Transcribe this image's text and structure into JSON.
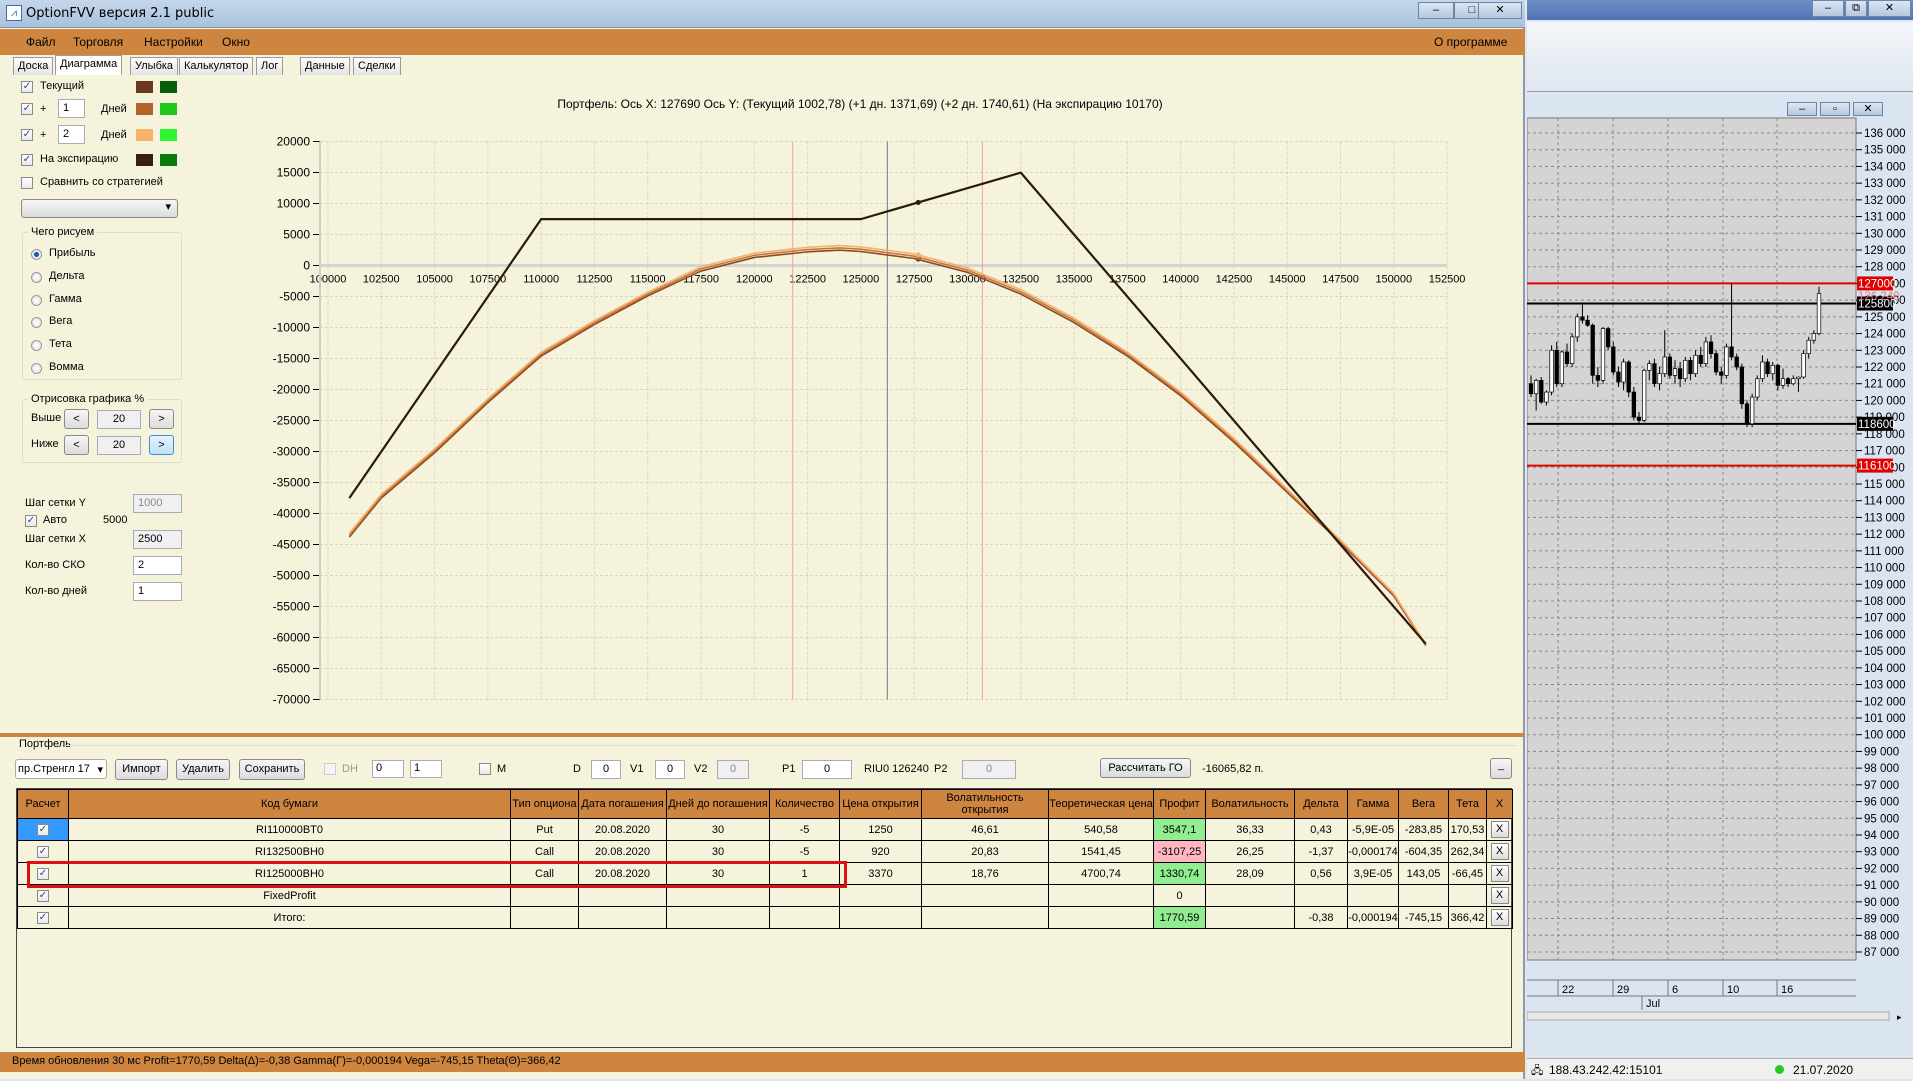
{
  "window": {
    "title": "OptionFVV версия 2.1 public",
    "min": "‒",
    "max": "□",
    "close": "✕"
  },
  "menu": {
    "items": [
      "Файл",
      "Торговля",
      "Настройки",
      "Окно"
    ],
    "about": "О программе"
  },
  "tabs": [
    "Доска",
    "Диаграмма",
    "Улыбка",
    "Калькулятор",
    "Лог",
    "Данные",
    "Сделки"
  ],
  "active_tab": "Диаграмма",
  "left": {
    "series": [
      {
        "label": "Текущий",
        "checked": true,
        "color": "#6b3a1e",
        "color2": "#0a5e0a"
      },
      {
        "label": "+",
        "days": "1",
        "unit": "Дней",
        "checked": true,
        "color": "#b5612b",
        "color2": "#1ec81e"
      },
      {
        "label": "+",
        "days": "2",
        "unit": "Дней",
        "checked": true,
        "color": "#f7b26c",
        "color2": "#2ef52e"
      },
      {
        "label": "На экспирацию",
        "checked": true,
        "color": "#3a1f0a",
        "color2": "#0a7a0a"
      }
    ],
    "compare": {
      "label": "Сравнить со стратегией",
      "checked": false,
      "select": ""
    },
    "draw_group": {
      "title": "Чего рисуем",
      "options": [
        "Прибыль",
        "Дельта",
        "Гамма",
        "Вега",
        "Тета",
        "Вомма"
      ],
      "selected": "Прибыль"
    },
    "range_group": {
      "title": "Отрисовка графика %",
      "above_label": "Выше",
      "above": "20",
      "below_label": "Ниже",
      "below": "20",
      "dec": "<",
      "inc": ">"
    },
    "grid_y_label": "Шаг сетки Y",
    "grid_y": "1000",
    "auto_label": "Авто",
    "auto_checked": true,
    "auto_value": "5000",
    "grid_x_label": "Шаг сетки X",
    "grid_x": "2500",
    "sko_label": "Кол-во СКО",
    "sko": "2",
    "days_label": "Кол-во дней",
    "days": "1"
  },
  "chart_data": {
    "type": "line",
    "title": "Портфель: Ось X: 127690 Ось Y:  (Текущий 1002,78)  (+1 дн. 1371,69)  (+2 дн. 1740,61)  (На экспирацию 10170)",
    "xlim": [
      100000,
      152500
    ],
    "ylim": [
      -70000,
      20000
    ],
    "x_ticks": [
      100000,
      102500,
      105000,
      107500,
      110000,
      112500,
      115000,
      117500,
      120000,
      122500,
      125000,
      127500,
      130000,
      132500,
      135000,
      137500,
      140000,
      142500,
      145000,
      147500,
      150000,
      152500
    ],
    "y_ticks": [
      20000,
      15000,
      10000,
      5000,
      0,
      -5000,
      -10000,
      -15000,
      -20000,
      -25000,
      -30000,
      -35000,
      -40000,
      -45000,
      -50000,
      -55000,
      -60000,
      -65000,
      -70000
    ],
    "grid": true,
    "cursor_x": 127690,
    "current_price": 126240,
    "sko_bounds": [
      121800,
      130700
    ],
    "x": [
      101000,
      102500,
      105000,
      107500,
      110000,
      112500,
      115000,
      117500,
      120000,
      122500,
      124000,
      125000,
      127500,
      130000,
      132500,
      135000,
      137500,
      140000,
      142500,
      145000,
      147500,
      150000,
      151500
    ],
    "series": [
      {
        "name": "Текущий",
        "color": "#8a4a20",
        "values": [
          -43800,
          -37500,
          -30200,
          -22100,
          -14600,
          -9500,
          -4900,
          -900,
          1300,
          2200,
          2470,
          2260,
          1130,
          -1100,
          -4600,
          -9200,
          -14600,
          -21000,
          -28500,
          -36600,
          -44700,
          -53300,
          -61300
        ]
      },
      {
        "name": "+1 дн.",
        "color": "#c8763a",
        "values": [
          -43500,
          -37200,
          -29900,
          -21800,
          -14300,
          -9200,
          -4600,
          -550,
          1650,
          2570,
          2840,
          2630,
          1500,
          -750,
          -4250,
          -8850,
          -14300,
          -20700,
          -28200,
          -36350,
          -44500,
          -53100,
          -61200
        ]
      },
      {
        "name": "+2 дн.",
        "color": "#f5b070",
        "values": [
          -43200,
          -36900,
          -29600,
          -21500,
          -14000,
          -8900,
          -4300,
          -200,
          2000,
          2940,
          3210,
          3000,
          1870,
          -400,
          -3900,
          -8500,
          -14000,
          -20400,
          -27900,
          -36100,
          -44300,
          -52900,
          -61100
        ]
      },
      {
        "name": "На экспирацию",
        "color": "#2b1a08",
        "x": [
          101000,
          110000,
          125000,
          132500,
          151500
        ],
        "values": [
          -37520,
          7480,
          7480,
          14980,
          -61020
        ]
      }
    ],
    "markers": [
      {
        "series": "Текущий",
        "x": 127690,
        "y": 1002.78
      },
      {
        "series": "+1 дн.",
        "x": 127690,
        "y": 1371.69
      },
      {
        "series": "+2 дн.",
        "x": 127690,
        "y": 1740.61
      },
      {
        "series": "На экспирацию",
        "x": 127690,
        "y": 10170
      }
    ]
  },
  "portfolio": {
    "title": "Портфель",
    "strategy": "пр.Стренгл 17",
    "import": "Импорт",
    "delete": "Удалить",
    "save": "Сохранить",
    "dh_label": "DH",
    "spin1": "0",
    "spin2": "1",
    "m_label": "M",
    "d_label": "D",
    "d": "0",
    "v1_label": "V1",
    "v1": "0",
    "v2_label": "V2",
    "v2": "0",
    "p1_label": "P1",
    "p1": "0",
    "ticker": "RIU0 126240",
    "p2_label": "P2",
    "p2": "0",
    "calc_go": "Рассчитать ГО",
    "go_value": "-16065,82 п.",
    "minimize": "_",
    "columns": [
      "Расчет",
      "Код бумаги",
      "Тип опциона",
      "Дата погашения",
      "Дней до погашения",
      "Количество",
      "Цена открытия",
      "Волатильность открытия",
      "Теоретическая цена",
      "Профит",
      "Волатильность",
      "Дельта",
      "Гамма",
      "Вега",
      "Тета",
      "X"
    ],
    "rows": [
      {
        "calc": true,
        "code": "RI110000BT0",
        "type": "Put",
        "date": "20.08.2020",
        "days": "30",
        "qty": "-5",
        "open": "1250",
        "vol_open": "46,61",
        "theo": "540,58",
        "profit": "3547,1",
        "profit_state": "pos",
        "vol": "36,33",
        "delta": "0,43",
        "gamma": "-5,9E-05",
        "vega": "-283,85",
        "theta": "170,53",
        "x": "X"
      },
      {
        "calc": true,
        "code": "RI132500BH0",
        "type": "Call",
        "date": "20.08.2020",
        "days": "30",
        "qty": "-5",
        "open": "920",
        "vol_open": "20,83",
        "theo": "1541,45",
        "profit": "-3107,25",
        "profit_state": "neg",
        "vol": "26,25",
        "delta": "-1,37",
        "gamma": "-0,000174",
        "vega": "-604,35",
        "theta": "262,34",
        "x": "X"
      },
      {
        "calc": true,
        "code": "RI125000BH0",
        "type": "Call",
        "date": "20.08.2020",
        "days": "30",
        "qty": "1",
        "open": "3370",
        "vol_open": "18,76",
        "theo": "4700,74",
        "profit": "1330,74",
        "profit_state": "pos",
        "vol": "28,09",
        "delta": "0,56",
        "gamma": "3,9E-05",
        "vega": "143,05",
        "theta": "-66,45",
        "x": "X"
      },
      {
        "calc": true,
        "code": "FixedProfit",
        "type": "",
        "date": "",
        "days": "",
        "qty": "",
        "open": "",
        "vol_open": "",
        "theo": "",
        "profit": "0",
        "profit_state": "",
        "vol": "",
        "delta": "",
        "gamma": "",
        "vega": "",
        "theta": "",
        "x": "X"
      },
      {
        "calc": true,
        "code": "Итого:",
        "type": "",
        "date": "",
        "days": "",
        "qty": "",
        "open": "",
        "vol_open": "",
        "theo": "",
        "profit": "1770,59",
        "profit_state": "pos",
        "vol": "",
        "delta": "-0,38",
        "gamma": "-0,000194",
        "vega": "-745,15",
        "theta": "366,42",
        "x": "X"
      }
    ]
  },
  "status": "Время обновления 30 мс  Profit=1770,59 Delta(Δ)=-0,38 Gamma(Γ)=-0,000194 Vega=-745,15 Theta(Θ)=366,42",
  "price_chart": {
    "y_labels": [
      "136 000",
      "135 000",
      "134 000",
      "133 000",
      "132 000",
      "131 000",
      "130 000",
      "129 000",
      "128 000",
      "127 000",
      "126 000",
      "125 000",
      "124 000",
      "123 000",
      "122 000",
      "121 000",
      "120 000",
      "119 000",
      "118 000",
      "117 000",
      "116 000",
      "115 000",
      "114 000",
      "113 000",
      "112 000",
      "111 000",
      "110 000",
      "109 000",
      "108 000",
      "107 000",
      "106 000",
      "105 000",
      "104 000",
      "103 000",
      "102 000",
      "101 000",
      "100 000",
      "99 000",
      "98 000",
      "97 000",
      "96 000",
      "95 000",
      "94 000",
      "93 000",
      "92 000",
      "91 000",
      "90 000",
      "89 000",
      "88 000",
      "87 000"
    ],
    "levels": [
      {
        "value": 127000,
        "label": "127000",
        "color": "#e00000"
      },
      {
        "value": 125800,
        "label": "125800",
        "color": "#000000"
      },
      {
        "value": 118600,
        "label": "118600",
        "color": "#000000"
      },
      {
        "value": 116100,
        "label": "116100",
        "color": "#e00000"
      }
    ],
    "last_price": "126 240",
    "dates": [
      "22",
      "29",
      "6",
      "10",
      "16"
    ],
    "month": "Jul",
    "candles": [
      [
        121.0,
        121.5,
        120.2,
        120.4
      ],
      [
        120.4,
        121.3,
        119.4,
        121.2
      ],
      [
        121.2,
        121.4,
        119.8,
        119.9
      ],
      [
        119.9,
        120.6,
        119.7,
        120.5
      ],
      [
        120.5,
        123.3,
        120.3,
        123.0
      ],
      [
        123.0,
        123.5,
        120.8,
        121.0
      ],
      [
        121.0,
        123.0,
        120.8,
        122.9
      ],
      [
        122.9,
        123.4,
        122.0,
        122.2
      ],
      [
        122.2,
        124.0,
        122.0,
        123.8
      ],
      [
        123.8,
        125.2,
        123.5,
        125.0
      ],
      [
        125.0,
        125.8,
        124.6,
        124.8
      ],
      [
        124.8,
        125.1,
        124.4,
        124.5
      ],
      [
        124.5,
        124.6,
        121.0,
        121.5
      ],
      [
        121.5,
        122.0,
        120.8,
        121.2
      ],
      [
        121.2,
        124.4,
        121.0,
        124.3
      ],
      [
        124.3,
        124.4,
        123.0,
        123.2
      ],
      [
        123.2,
        123.5,
        121.5,
        121.7
      ],
      [
        121.7,
        122.0,
        120.8,
        121.1
      ],
      [
        121.1,
        122.5,
        120.6,
        122.3
      ],
      [
        122.3,
        122.4,
        120.2,
        120.5
      ],
      [
        120.5,
        120.8,
        118.8,
        119.0
      ],
      [
        119.0,
        119.3,
        118.6,
        118.8
      ],
      [
        118.8,
        121.9,
        118.7,
        121.8
      ],
      [
        121.8,
        122.4,
        121.2,
        122.2
      ],
      [
        122.2,
        122.5,
        120.8,
        121.0
      ],
      [
        121.0,
        122.0,
        120.6,
        121.6
      ],
      [
        121.6,
        124.2,
        121.4,
        122.6
      ],
      [
        122.6,
        122.8,
        121.3,
        121.5
      ],
      [
        121.5,
        122.4,
        121.0,
        121.9
      ],
      [
        121.9,
        122.3,
        120.8,
        121.3
      ],
      [
        121.3,
        122.6,
        121.1,
        122.4
      ],
      [
        122.4,
        122.6,
        121.2,
        121.6
      ],
      [
        121.6,
        123.0,
        121.4,
        122.7
      ],
      [
        122.7,
        123.2,
        122.0,
        122.2
      ],
      [
        122.2,
        123.8,
        122.0,
        123.5
      ],
      [
        123.5,
        123.9,
        122.5,
        122.8
      ],
      [
        122.8,
        123.0,
        121.5,
        121.7
      ],
      [
        121.7,
        122.0,
        121.0,
        121.5
      ],
      [
        121.5,
        123.4,
        121.3,
        123.2
      ],
      [
        123.2,
        127.0,
        122.4,
        122.6
      ],
      [
        122.6,
        122.8,
        121.8,
        122.0
      ],
      [
        122.0,
        122.2,
        119.5,
        119.8
      ],
      [
        119.8,
        120.0,
        118.4,
        118.6
      ],
      [
        118.6,
        120.4,
        118.4,
        120.2
      ],
      [
        120.2,
        121.5,
        120.0,
        121.3
      ],
      [
        121.3,
        122.7,
        121.1,
        122.3
      ],
      [
        122.3,
        122.5,
        121.4,
        121.6
      ],
      [
        121.6,
        122.3,
        121.2,
        122.1
      ],
      [
        122.1,
        122.2,
        120.6,
        120.9
      ],
      [
        120.9,
        121.9,
        120.7,
        121.3
      ],
      [
        121.3,
        121.4,
        120.8,
        121.0
      ],
      [
        121.0,
        121.5,
        120.9,
        121.3
      ],
      [
        121.3,
        121.4,
        120.5,
        121.4
      ],
      [
        121.4,
        123.0,
        121.3,
        122.8
      ],
      [
        122.8,
        123.8,
        122.5,
        123.6
      ],
      [
        123.6,
        124.2,
        123.4,
        124.0
      ],
      [
        124.0,
        126.8,
        123.9,
        126.4
      ]
    ],
    "connection": "188.43.242.42:15101",
    "date": "21.07.2020"
  }
}
